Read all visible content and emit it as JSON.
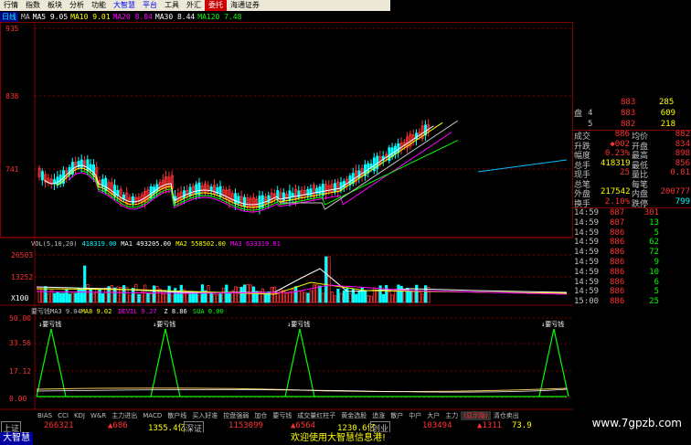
{
  "menu": {
    "items": [
      {
        "label": "行情",
        "style": "normal"
      },
      {
        "label": "指数",
        "style": "normal"
      },
      {
        "label": "板块",
        "style": "normal"
      },
      {
        "label": "分析",
        "style": "normal"
      },
      {
        "label": "功能",
        "style": "normal"
      },
      {
        "label": "大智慧",
        "style": "blue"
      },
      {
        "label": "平台",
        "style": "blue"
      },
      {
        "label": "工具",
        "style": "normal"
      },
      {
        "label": "外汇",
        "style": "normal"
      },
      {
        "label": "委托",
        "style": "red"
      },
      {
        "label": "海通证券",
        "style": "normal"
      }
    ]
  },
  "period_bar": {
    "period": "日线",
    "ma_legend": [
      {
        "text": "MA",
        "color": "#c0c0c0"
      },
      {
        "text": "MA5 9.05",
        "color": "#ffffff"
      },
      {
        "text": "MA10 9.01",
        "color": "#ffff00"
      },
      {
        "text": "MA20 8.84",
        "color": "#ff00ff"
      },
      {
        "text": "MA30 8.44",
        "color": "#ffffff"
      },
      {
        "text": "MA120 7.48",
        "color": "#00ff00"
      }
    ]
  },
  "price_axis": {
    "labels": [
      "935",
      "838",
      "741"
    ]
  },
  "volume_panel": {
    "legend": [
      {
        "text": "VOL(5,10,20)",
        "color": "#c0c0c0"
      },
      {
        "text": "418319.00",
        "color": "#00ffff"
      },
      {
        "text": "MA1 493205.00",
        "color": "#ffffff"
      },
      {
        "text": "MA2 558502.00",
        "color": "#ffff00"
      },
      {
        "text": "MA3 633319.81",
        "color": "#ff00ff"
      }
    ],
    "axis": [
      "26503",
      "13252",
      "X100"
    ]
  },
  "indicator_panel": {
    "legend": [
      {
        "text": "要亏钱MA3 9.04",
        "color": "#c0c0c0"
      },
      {
        "text": "MA8 9.02",
        "color": "#ffff00"
      },
      {
        "text": "DEVIL 9.27",
        "color": "#ff00ff"
      },
      {
        "text": "Z 8.86",
        "color": "#ffffff"
      },
      {
        "text": "SUA 0.00",
        "color": "#00ff00"
      }
    ],
    "axis": [
      "50.00",
      "33.56",
      "17.12",
      "0.00"
    ],
    "signals": [
      "↓要亏钱",
      "↓要亏钱",
      "↓要亏钱",
      "↓要亏钱"
    ]
  },
  "quote": {
    "levels": [
      {
        "name": "4",
        "price": "883",
        "vol": "609"
      },
      {
        "name": "5",
        "price": "882",
        "vol": "218"
      }
    ],
    "side_label": "盘",
    "stats": [
      {
        "l1": "成交",
        "v1": "886",
        "l2": "均价",
        "v2": "882"
      },
      {
        "l1": "升跌",
        "v1": "◆002",
        "l2": "开盘",
        "v2": "834"
      },
      {
        "l1": "幅度",
        "v1": "0.23%",
        "l2": "最高",
        "v2": "898"
      },
      {
        "l1": "总手",
        "v1": "418319",
        "l2": "最低",
        "v2": "856"
      },
      {
        "l1": "现手",
        "v1": "25",
        "l2": "量比",
        "v2": "0.81"
      },
      {
        "l1": "总笔",
        "v1": "",
        "l2": "每笔",
        "v2": ""
      },
      {
        "l1": "外盘",
        "v1": "217542",
        "l2": "内盘",
        "v2": "200777"
      },
      {
        "l1": "换手",
        "v1": "2.10%",
        "l2": "跌停",
        "v2": "799"
      }
    ],
    "ticks": [
      {
        "time": "14:59",
        "price": "887",
        "vol": "301"
      },
      {
        "time": "14:59",
        "price": "887",
        "vol": "13"
      },
      {
        "time": "14:59",
        "price": "886",
        "vol": "5"
      },
      {
        "time": "14:59",
        "price": "886",
        "vol": "62"
      },
      {
        "time": "14:59",
        "price": "886",
        "vol": "72"
      },
      {
        "time": "14:59",
        "price": "886",
        "vol": "9"
      },
      {
        "time": "14:59",
        "price": "886",
        "vol": "10"
      },
      {
        "time": "14:59",
        "price": "886",
        "vol": "6"
      },
      {
        "time": "14:59",
        "price": "886",
        "vol": "5"
      },
      {
        "time": "15:00",
        "price": "886",
        "vol": "25"
      }
    ]
  },
  "tabs": [
    "BIAS",
    "CCI",
    "KDJ",
    "W&R",
    "主力进出",
    "MACD",
    "散户线",
    "买入好准",
    "控盘强弱",
    "加仓",
    "要亏钱",
    "成交量红柱子",
    "黄金选股",
    "追涨",
    "散户",
    "中户",
    "大户",
    "主力",
    "(显示隐)",
    "清仓卖出"
  ],
  "status": {
    "sh_label": "上证",
    "sh_vol": "266321",
    "sh_chg": "686",
    "sh_idx": "1355.4亿",
    "sz_label": "深证",
    "sz_vol": "1153099",
    "sz_chg": "6564",
    "sz_idx": "1230.6亿",
    "cy_label": "创业",
    "cy_vol": "103494",
    "cy_chg": "1311",
    "cy_idx": "73.9"
  },
  "footer": {
    "logo": "大智慧",
    "message": "欢迎使用大智慧信息港!",
    "watermark": "www.7gpzb.com"
  },
  "colors": {
    "up": "#ff3232",
    "down": "#00ffff",
    "bg": "#000000",
    "grid": "#800000"
  }
}
